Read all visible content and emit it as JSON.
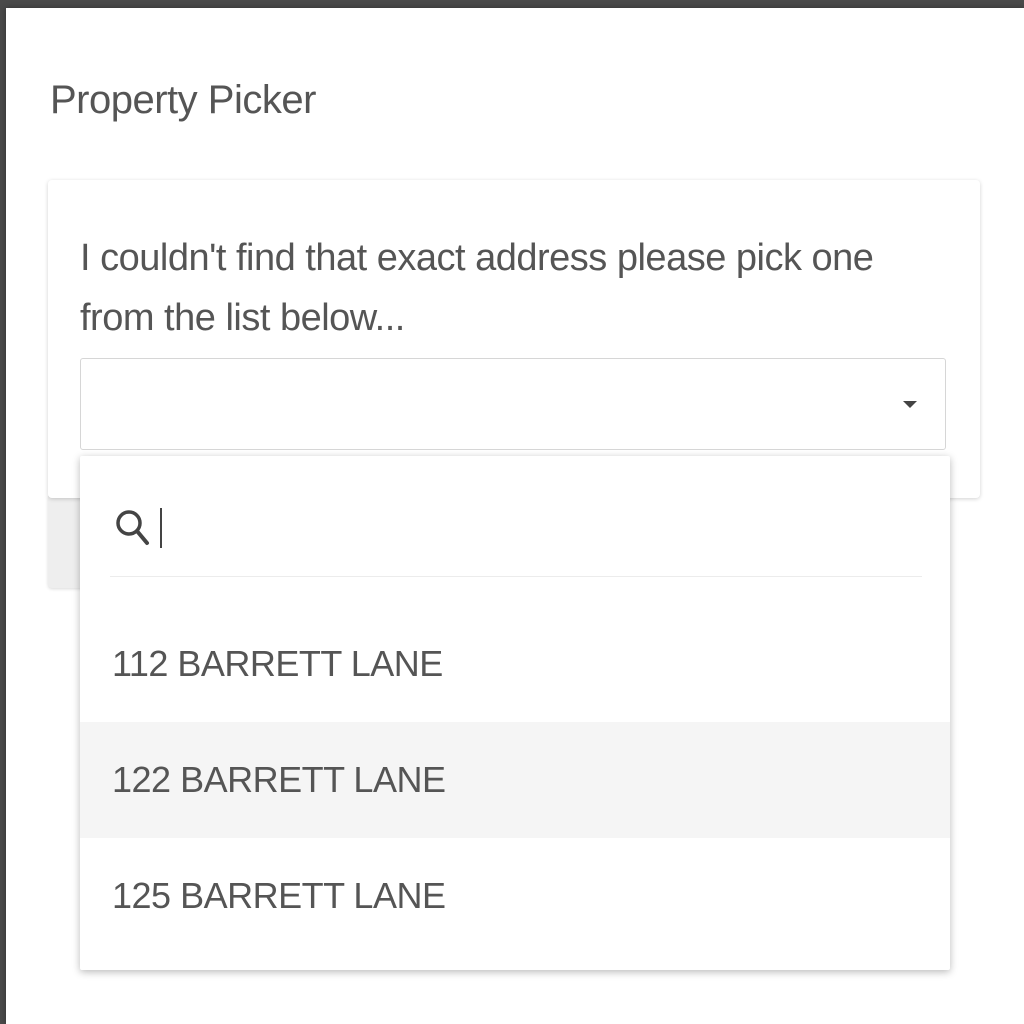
{
  "dialog": {
    "title": "Property Picker",
    "message": "I couldn't find that exact address please pick one from the list below...",
    "select": {
      "value": ""
    },
    "dropdown": {
      "search_value": "",
      "options": [
        {
          "label": "112 BARRETT LANE",
          "highlighted": false
        },
        {
          "label": "122 BARRETT LANE",
          "highlighted": true
        },
        {
          "label": "125 BARRETT LANE",
          "highlighted": false
        }
      ]
    }
  },
  "icons": {
    "search": "search-icon",
    "caret": "caret-down-icon"
  },
  "colors": {
    "text": "#555555",
    "highlight": "#f5f5f5",
    "border": "#d6d6d6"
  }
}
